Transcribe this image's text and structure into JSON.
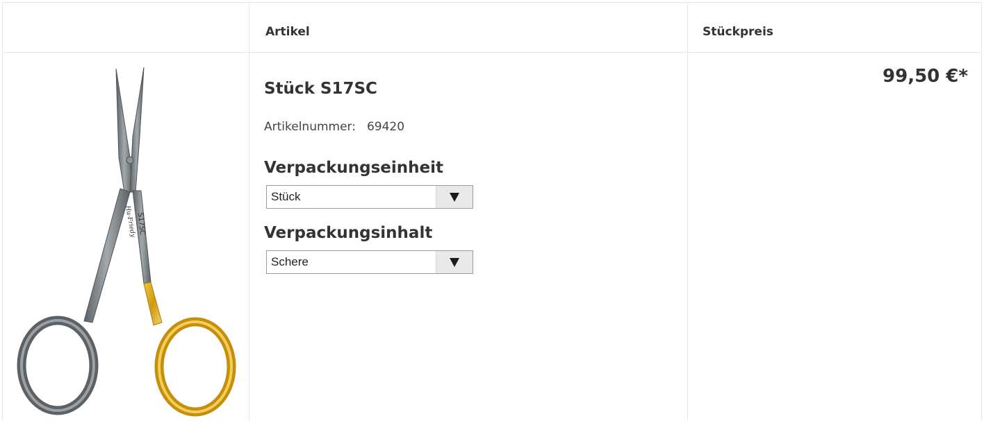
{
  "header": {
    "col_image": "",
    "col_article": "Artikel",
    "col_price": "Stückpreis"
  },
  "product": {
    "title": "Stück S17SC",
    "article_number_label": "Artikelnummer:",
    "article_number": "69420",
    "packaging_unit": {
      "label": "Verpackungseinheit",
      "selected": "Stück"
    },
    "packaging_content": {
      "label": "Verpackungsinhalt",
      "selected": "Schere"
    },
    "price": "99,50 €*",
    "image_engraving": "S17SC",
    "image_brand": "Hu-Friedy",
    "image_icon": "scissors-icon"
  },
  "colors": {
    "grid": "#e7e7e7",
    "gold": "#d6a21c",
    "steel": "#6e7478"
  }
}
